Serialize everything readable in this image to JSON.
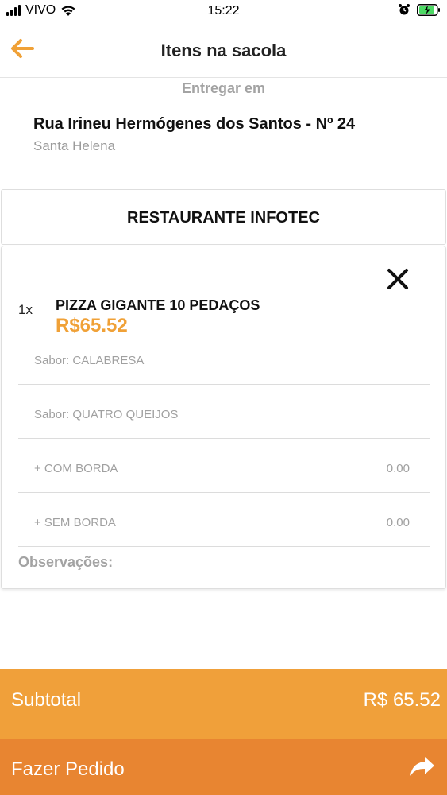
{
  "status_bar": {
    "carrier": "VIVO",
    "time": "15:22"
  },
  "nav": {
    "title": "Itens na sacola",
    "back_icon": "arrow-left-icon"
  },
  "delivery": {
    "label": "Entregar em",
    "street": "Rua Irineu Hermógenes dos Santos - Nº 24",
    "district": "Santa Helena"
  },
  "restaurant": {
    "name": "RESTAURANTE INFOTEC"
  },
  "cart_item": {
    "quantity": "1x",
    "name": "PIZZA GIGANTE 10 PEDAÇOS",
    "price": "R$65.52",
    "options": [
      {
        "label": "Sabor: CALABRESA",
        "value": ""
      },
      {
        "label": "Sabor: QUATRO QUEIJOS",
        "value": ""
      },
      {
        "label": "+ COM BORDA",
        "value": "0.00"
      },
      {
        "label": "+ SEM BORDA",
        "value": "0.00"
      }
    ],
    "notes_label": "Observações:"
  },
  "footer": {
    "subtotal_label": "Subtotal",
    "subtotal_value": "R$ 65.52",
    "order_label": "Fazer Pedido"
  },
  "colors": {
    "accent": "#f0a137",
    "subtotal_bg": "#f0a03a",
    "order_bg": "#e88531"
  }
}
